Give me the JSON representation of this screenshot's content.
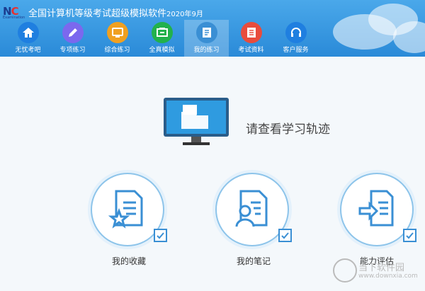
{
  "app": {
    "title": "全国计算机等级考试超级模拟软件",
    "date": "2020年9月"
  },
  "logo": {
    "mark_left": "N",
    "mark_right": "C",
    "sub": "Examination"
  },
  "nav": [
    {
      "label": "无忧考吧",
      "icon": "home-icon",
      "color": "#1f7fe0"
    },
    {
      "label": "专项练习",
      "icon": "pencil-icon",
      "color": "#7b68ee"
    },
    {
      "label": "综合练习",
      "icon": "monitor-icon",
      "color": "#f0a020"
    },
    {
      "label": "全真模拟",
      "icon": "exam-icon",
      "color": "#22b14c"
    },
    {
      "label": "我的练习",
      "icon": "notebook-icon",
      "color": "#3a8fd4",
      "active": true
    },
    {
      "label": "考试资料",
      "icon": "document-icon",
      "color": "#e84c3d"
    },
    {
      "label": "客户服务",
      "icon": "headset-icon",
      "color": "#1f7fe0"
    }
  ],
  "main": {
    "prompt": "请查看学习轨迹"
  },
  "features": [
    {
      "label": "我的收藏",
      "icon": "favorite-document-icon"
    },
    {
      "label": "我的笔记",
      "icon": "note-document-icon"
    },
    {
      "label": "能力评估",
      "icon": "assessment-document-icon"
    }
  ],
  "watermark": {
    "text": "当下软件园",
    "url": "www.downxia.com"
  }
}
